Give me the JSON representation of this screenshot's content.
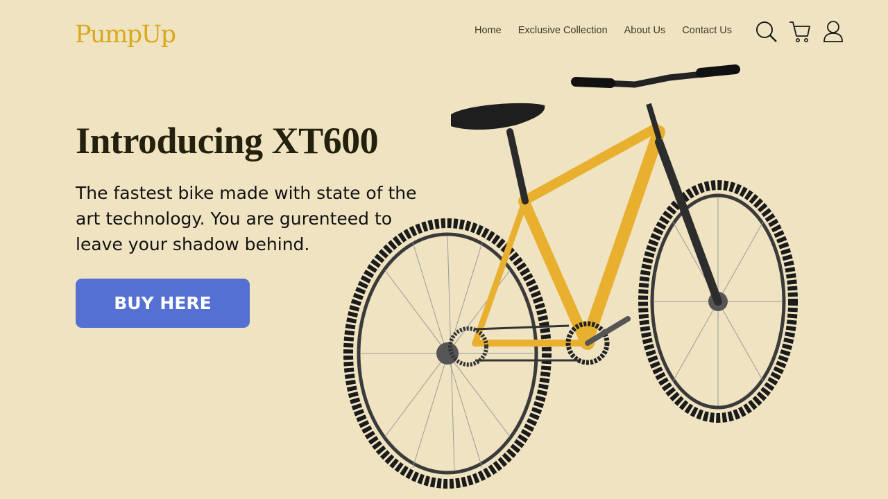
{
  "brand": {
    "logo_text": "PumpUp",
    "logo_color": "#d9a81b"
  },
  "nav": {
    "items": [
      {
        "label": "Home"
      },
      {
        "label": "Exclusive Collection"
      },
      {
        "label": "About Us"
      },
      {
        "label": "Contact Us"
      }
    ]
  },
  "header_icons": [
    "search-icon",
    "cart-icon",
    "user-icon"
  ],
  "hero": {
    "title": "Introducing XT600",
    "subtitle": "The fastest bike made with state of the art technology. You are gurenteed to leave your shadow behind.",
    "cta_label": "BUY HERE"
  },
  "colors": {
    "background": "#efe3c1",
    "cta": "#5470d3",
    "bike_frame": "#e8b02e"
  }
}
